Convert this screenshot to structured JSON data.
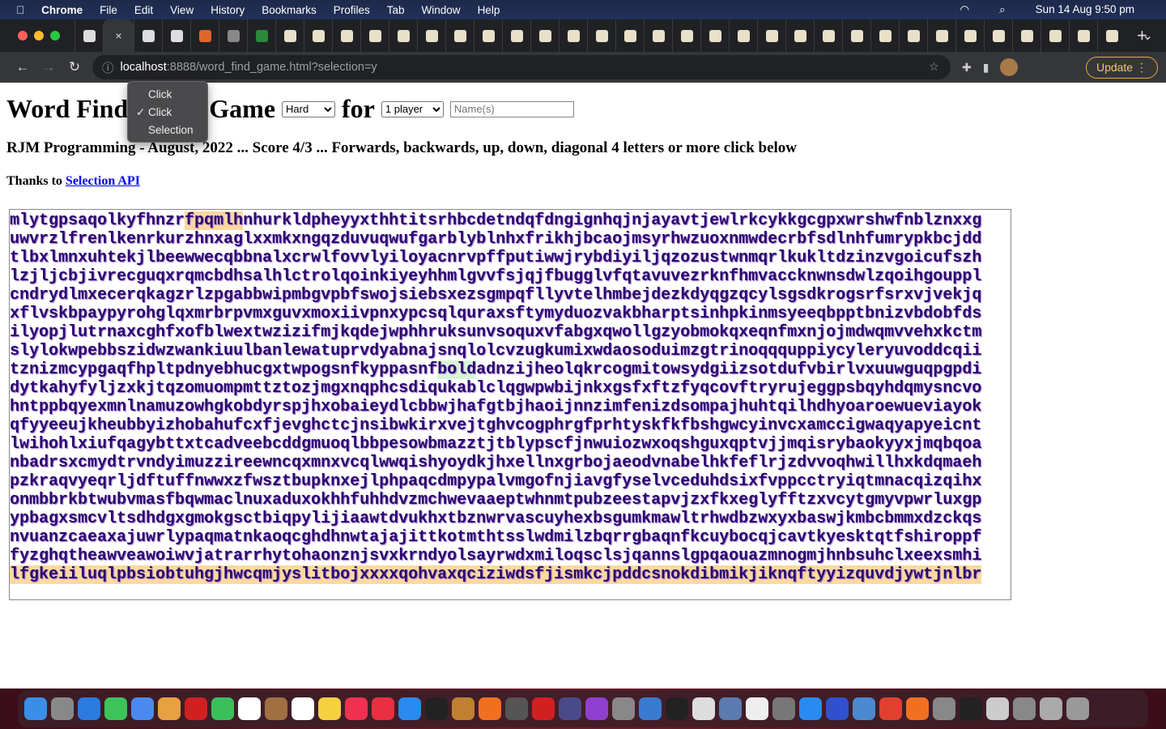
{
  "menubar": {
    "app": "Chrome",
    "items": [
      "File",
      "Edit",
      "View",
      "History",
      "Bookmarks",
      "Profiles",
      "Tab",
      "Window",
      "Help"
    ],
    "datetime": "Sun 14 Aug  9:50 pm"
  },
  "browser": {
    "url_host": "localhost",
    "url_rest": ":8888/word_find_game.html?selection=y",
    "update_label": "Update",
    "tab_close": "×",
    "tab_count": 37
  },
  "page": {
    "title_left": "Word Find",
    "title_right": "Game",
    "for_label": "for",
    "difficulty": "Hard",
    "players": "1 player",
    "names_placeholder": "Name(s)",
    "subtitle": "RJM Programming - August, 2022 ... Score 4/3 ... Forwards, backwards, up, down, diagonal 4 letters or more click below",
    "thanks_prefix": "Thanks to ",
    "thanks_link": "Selection API"
  },
  "popup": {
    "items": [
      {
        "label": "Click",
        "checked": false
      },
      {
        "label": "Click",
        "checked": true
      },
      {
        "label": "Selection",
        "checked": false
      }
    ],
    "check": "✓"
  },
  "grid": {
    "rows": [
      "mlytgpsaqolkyfhnzrfpqmlhnhurkldpheyyxthhtitsrhbcdetndqfdngignhqjnjayavtjewlrkcykkgcgpxwrshwfnblznxxg",
      "uwvrzlfrenlkenrkurzhnxaglxxmkxngqzduvuqwufgarblyblnhxfrikhjbcaojmsyrhwzuoxnmwdecrbfsdlnhfumrypkbcjdd",
      "tlbxlmnxuhtekjlbeewwecqbbnalxcrwlfovvlyiloyacnrvpffputiwwjrybdiyiljqzozustwnmqrlkukltdzinzvgoicufszh",
      "lzjljcbjivrecguqxrqmcbdhsalhlctrolqoinkiyeyhhmlgvvfsjqjfbugglvfqtavuvezrknfhmvaccknwnsdwlzqoihgouppl",
      "cndrydlmxecerqkagzrlzpgabbwipmbgvpbfswojsiebsxezsgmpqfllyvtelhmbejdezkdyqgzqcylsgsdkrogsrfsrxvjvekjq",
      "xflvskbpaypyrohglqxmrbrpvmxguvxmoxiivpnxypcsqlquraxsftymyduozvakbharptsinhpkinmsyeeqbpptbnizvbdobfds",
      "ilyopjlutrnaxcghfxofblwextwzizifmjkqdejwphhruksunvsoquxvfabgxqwollgzyobmokqxeqnfmxnjojmdwqmvvehxkctm",
      "slylokwpebbszidwzwankiuulbanlewatuprvdyabnajsnqlolcvzugkumixwdaosoduimzgtrinoqqquppiycyleryuvoddcqii",
      "tznizmcypgaqfhpltpdnyebhucgxtwpogsnfkyppasnfboldadnzijheolqkrcogmitowsydgiizsotdufvbirlvxuuwguqpgpdi",
      "dytkahyfyljzxkjtqzomuompmttztozjmgxnqphcsdiqukablclqgwpwbijnkxgsfxftzfyqcovftryrujeggpsbqyhdqmysncvo",
      "hntppbqyexmnlnamuzowhgkobdyrspjhxobaieydlcbbwjhafgtbjhaoijnnzimfenizdsompajhuhtqilhdhyoaroewueviayok",
      "qfyyeeujkheubbyizhobahufcxfjevghctcjnsibwkirxvejtghvcogphrgfprhtyskfkfbshgwcyinvcxamccigwaqyapyeicnt",
      "lwihohlxiufqagybttxtcadveebcddgmuoqlbbpesowbmazztjtblypscfjnwuiozwxoqshguxqptvjjmqisrybaokyyxjmqbqoa",
      "nbadrsxcmydtrvndyimuzzireewncqxmnxvcqlwwqishyoydkjhxellnxgrbojaeodvnabelhkfeflrjzdvvoqhwillhxkdqmaeh",
      "pzkraqvyeqrljdftuffnwwxzfwsztbupknxejlphpaqcdmpypalvmgofnjiavgfyselvceduhdsixfvppcctryiqtmnacqizqihx",
      "onmbbrkbtwubvmasfbqwmaclnuxaduxokhhfuhhdvzmchwevaaeptwhnmtpubzeestapvjzxfkxeglyfftzxvcytgmyvpwrluxgp",
      "ypbagxsmcvltsdhdgxgmokgsctbiqpylijiaawtdvukhxtbznwrvascuyhexbsgumkmawltrhwdbzwxyxbaswjkmbcbmmxdzckqs",
      "nvuanzcaeaxajuwrlypaqmatnkaoqcghdhnwtajajittkotmthtsslwdmilzbqrrgbaqnfkcuybocqjcavtkyesktqtfshiroppf",
      "fyzghqtheawveawoiwvjatrarrhytohaonznjsvxkrndyolsayrwdxmiloqsclsjqannslgpqaouazmnogmjhnbsuhclxeexsmhi",
      "lfgkeiiluqlpbsiobtuhgjhwcqmjyslitbojxxxxqohvaxqciziwdsfjismkcjpddcsnokdibmikjiknqftyyizquvdjywtjnlbr"
    ],
    "highlights": [
      {
        "row": 0,
        "start": 18,
        "length": 6,
        "color": "#fcd9a0"
      },
      {
        "row": 8,
        "start": 44,
        "length": 4,
        "color": "#d8f5d8"
      },
      {
        "row": 19,
        "start": 0,
        "length": 100,
        "color": "#fcd9a0"
      }
    ]
  }
}
